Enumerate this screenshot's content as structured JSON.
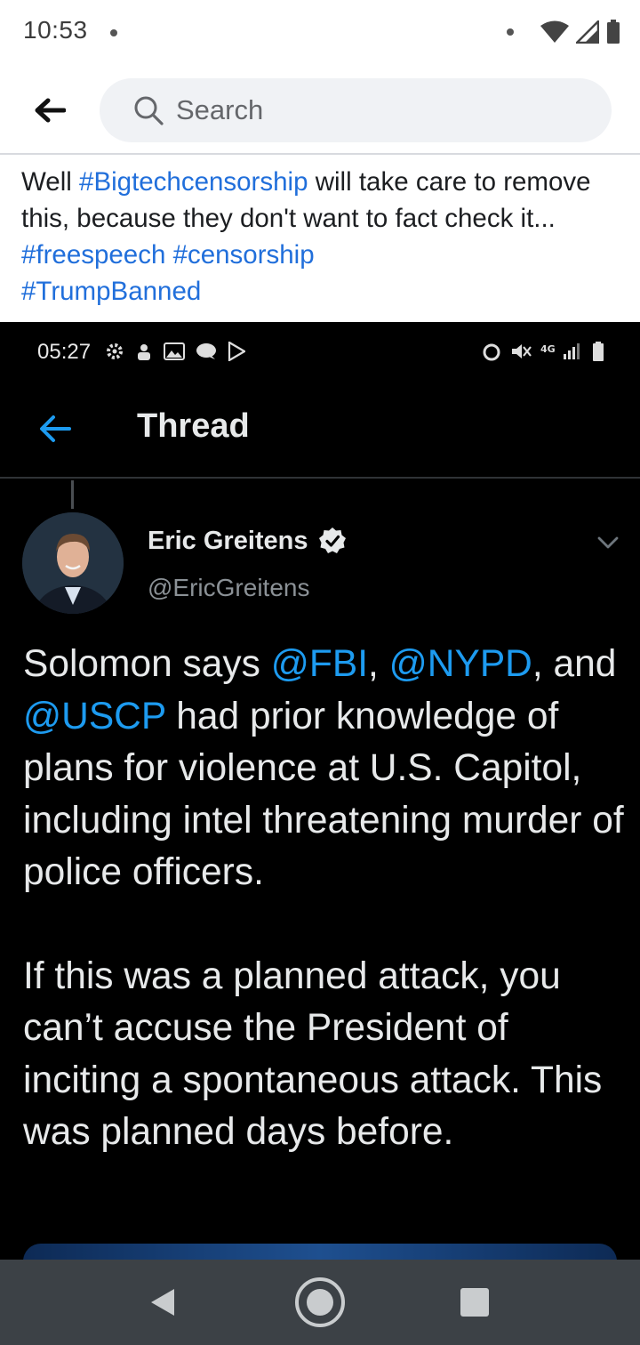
{
  "status_bar": {
    "time": "10:53"
  },
  "search": {
    "placeholder": "Search"
  },
  "post": {
    "t1": "Well ",
    "h1": "#Bigtechcensorship",
    "t2": " will take care to remove this, because they don't want to fact check it... ",
    "h2": "#freespeech",
    "t3": " ",
    "h3": "#censorship",
    "h4": "#TrumpBanned"
  },
  "embedded": {
    "status_time": "05:27",
    "nav_title": "Thread",
    "author_name": "Eric Greitens",
    "author_handle": "@EricGreitens",
    "tweet": {
      "p1_a": "Solomon says ",
      "m1": "@FBI",
      "p1_b": ", ",
      "m2": "@NYPD",
      "p1_c": ", and ",
      "m3": "@USCP",
      "p1_d": " had prior knowledge of plans for violence at U.S. Capitol, including intel threatening murder of police officers.",
      "p2": "If this was a planned attack, you can’t accuse the President of inciting a spontaneous attack. This was planned days before."
    }
  },
  "icons": [
    "back-arrow-icon",
    "search-icon",
    "wifi-icon",
    "signal-icon",
    "battery-icon",
    "verified-badge-icon",
    "chevron-down-icon",
    "nav-back-icon",
    "nav-home-icon",
    "nav-recents-icon"
  ],
  "colors": {
    "hashtag": "#216fdb",
    "mention": "#1d9bf0",
    "embed_bg": "#000000",
    "navbar": "#3c4146"
  }
}
